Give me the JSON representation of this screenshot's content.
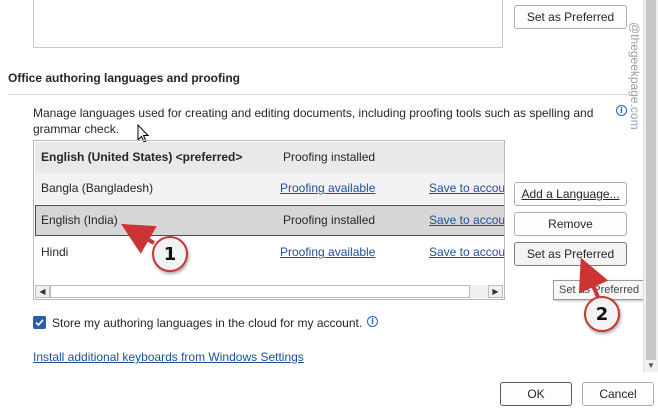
{
  "top": {
    "set_preferred_label": "Set as Preferred"
  },
  "section": {
    "heading": "Office authoring languages and proofing",
    "description": "Manage languages used for creating and editing documents, including proofing tools such as spelling and grammar check."
  },
  "languages": [
    {
      "name": "English (United States) <preferred>",
      "proofing": "Proofing installed",
      "save": "",
      "selected": false,
      "preferred": true
    },
    {
      "name": "Bangla (Bangladesh)",
      "proofing": "Proofing available",
      "save": "Save to accou",
      "selected": false,
      "preferred": false
    },
    {
      "name": "English (India)",
      "proofing": "Proofing installed",
      "save": "Save to accou",
      "selected": true,
      "preferred": false
    },
    {
      "name": "Hindi",
      "proofing": "Proofing available",
      "save": "Save to accou",
      "selected": false,
      "preferred": false
    }
  ],
  "buttons": {
    "add_language": "Add a Language...",
    "remove": "Remove",
    "set_preferred": "Set as Preferred",
    "ok": "OK",
    "cancel": "Cancel"
  },
  "tooltip": "Set as Preferred",
  "store_checkbox": {
    "label": "Store my authoring languages in the cloud for my account.",
    "checked": true
  },
  "install_link": "Install additional keyboards from Windows Settings",
  "watermark": "@thegeekpage.com",
  "annotations": [
    "1",
    "2"
  ],
  "colors": {
    "annotation_red": "#cc3333",
    "link_blue": "#1f4e9b",
    "checkbox_blue": "#2b5ea7"
  }
}
